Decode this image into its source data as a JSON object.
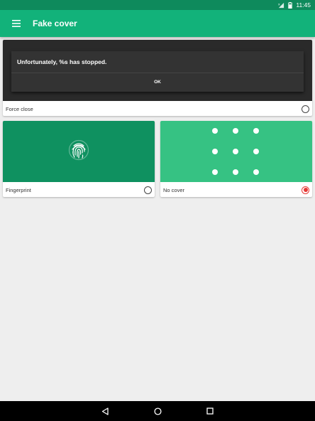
{
  "status_bar": {
    "time": "11:45"
  },
  "toolbar": {
    "title": "Fake cover",
    "menu_icon": "hamburger-menu-icon"
  },
  "cards": {
    "force_close": {
      "label": "Force close",
      "dialog_message": "Unfortunately, %s has stopped.",
      "dialog_button": "OK",
      "selected": false
    },
    "fingerprint": {
      "label": "Fingerprint",
      "icon": "fingerprint-icon",
      "selected": false
    },
    "no_cover": {
      "label": "No cover",
      "icon": "pattern-dots-icon",
      "selected": true
    }
  },
  "colors": {
    "status_bar": "#0e8a5c",
    "toolbar": "#12b27a",
    "fingerprint_bg": "#0f9160",
    "no_cover_bg": "#36c283",
    "radio_selected": "#e53935"
  },
  "nav_bar": {
    "back_icon": "back-icon",
    "home_icon": "home-icon",
    "recents_icon": "recents-icon"
  }
}
